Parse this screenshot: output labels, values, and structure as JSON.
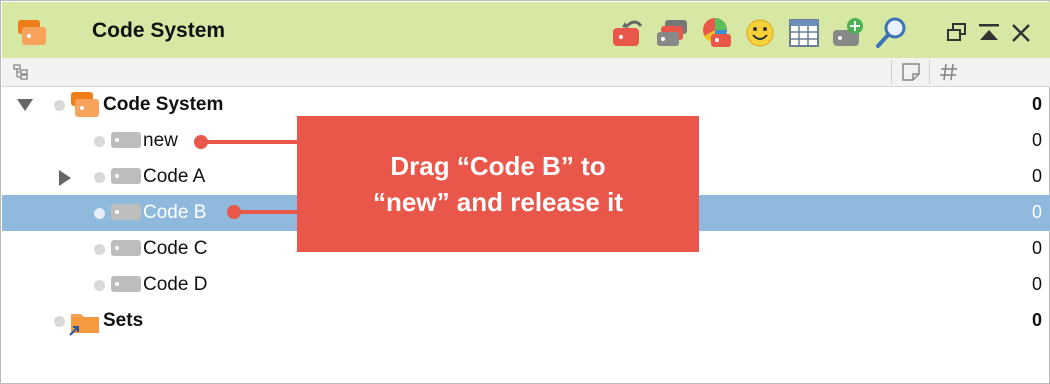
{
  "window": {
    "title": "Code System",
    "app_icon": "code-system-icon",
    "toolbar_icons": [
      "undo-code-icon",
      "tags-icon",
      "code-colors-icon",
      "smiley-icon",
      "table-icon",
      "add-code-icon",
      "search-icon"
    ],
    "window_buttons": [
      "undock-icon",
      "collapse-icon",
      "close-icon"
    ]
  },
  "columns": {
    "tree_icon": "hierarchy-icon",
    "memo_icon": "memo-icon",
    "count_icon": "hash-icon"
  },
  "tree": {
    "root": {
      "label": "Code System",
      "count": "0",
      "expanded": true
    },
    "codes": [
      {
        "label": "new",
        "count": "0"
      },
      {
        "label": "Code A",
        "count": "0",
        "has_children": true
      },
      {
        "label": "Code B",
        "count": "0",
        "selected": true
      },
      {
        "label": "Code C",
        "count": "0"
      },
      {
        "label": "Code D",
        "count": "0"
      }
    ],
    "sets": {
      "label": "Sets",
      "count": "0"
    }
  },
  "annotation": {
    "line1": "Drag “Code B” to",
    "line2": "“new” and release it"
  },
  "colors": {
    "titlebar": "#d6e8a4",
    "selection": "#90b9de",
    "callout": "#e9574a",
    "folder": "#f08a24"
  }
}
